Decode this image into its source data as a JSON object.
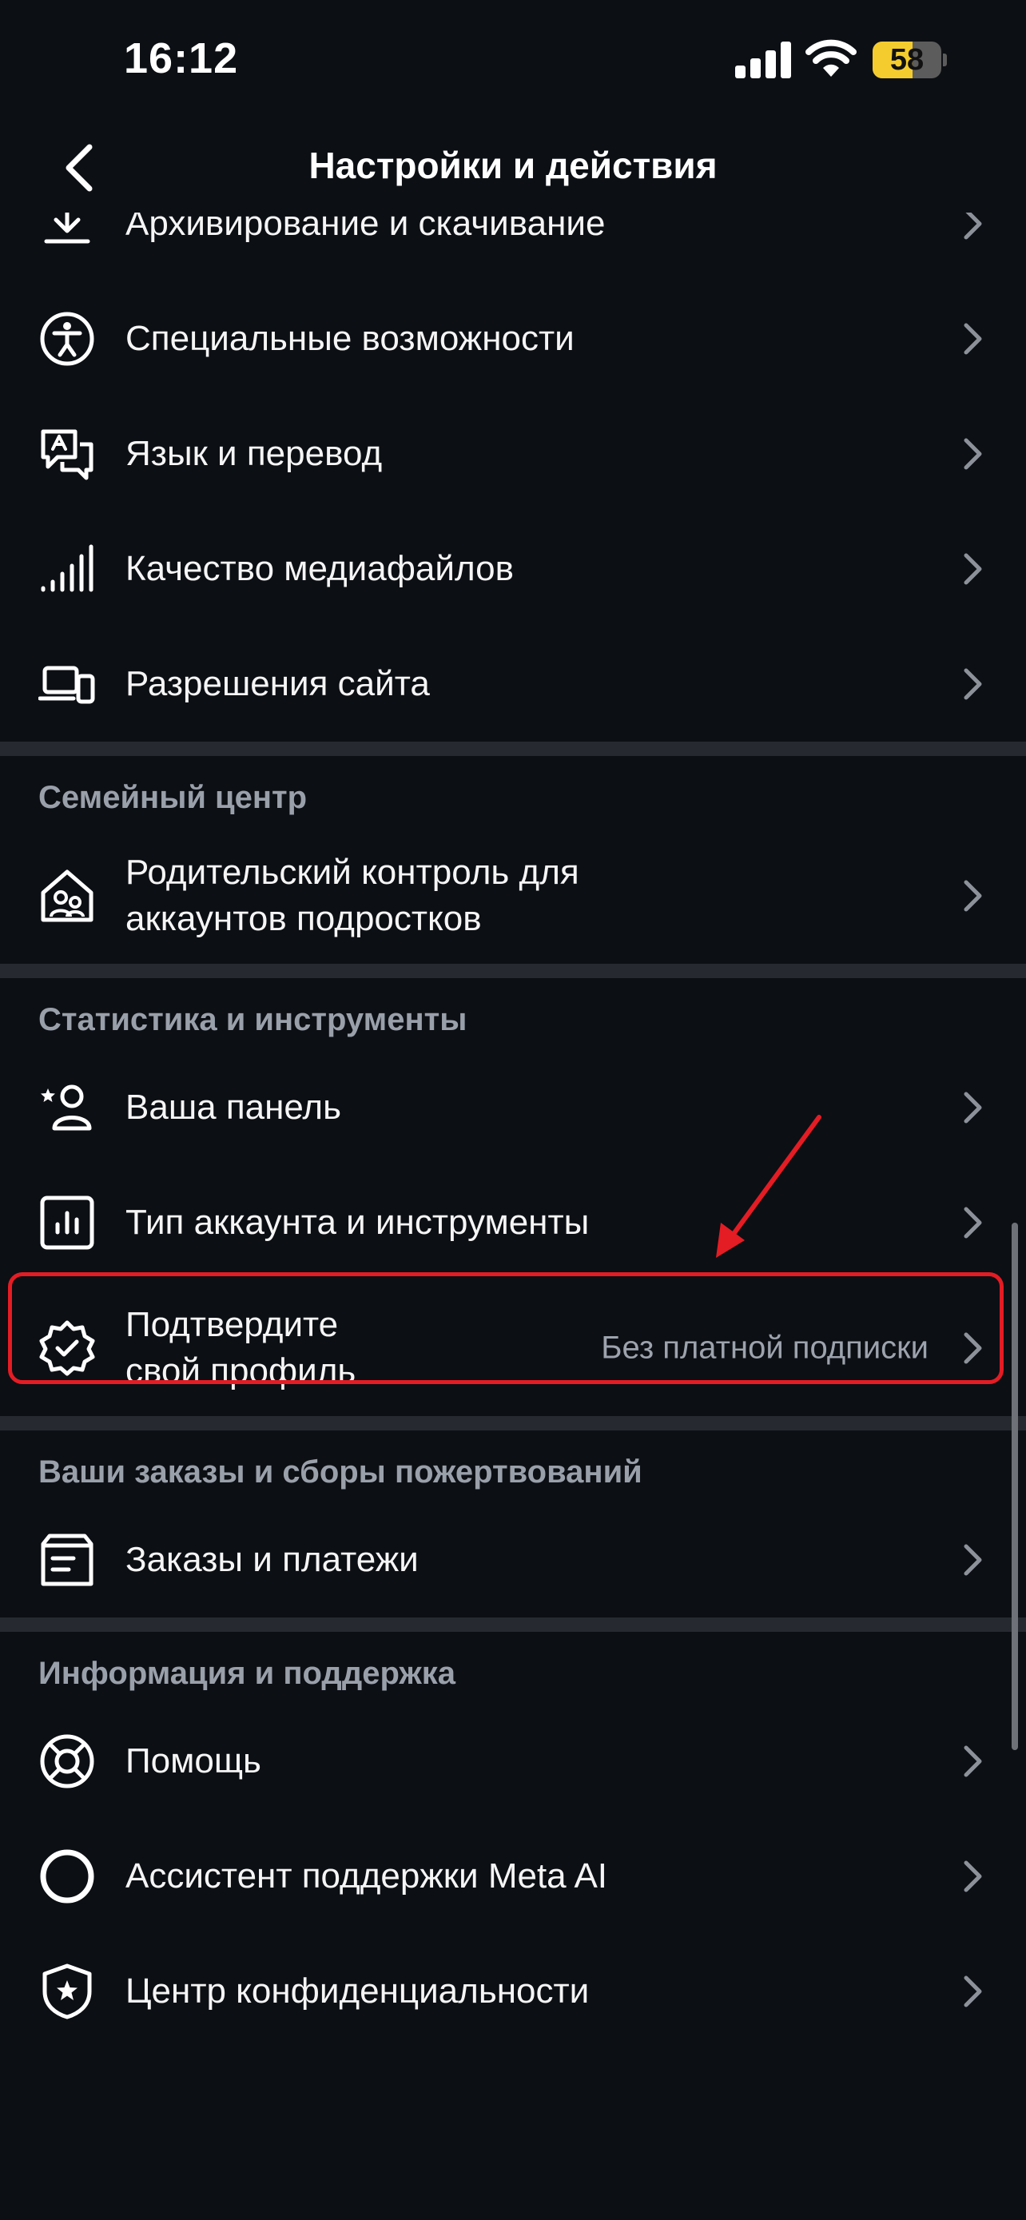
{
  "status_bar": {
    "time": "16:12",
    "battery": "58",
    "battery_level": 0.58
  },
  "header": {
    "title": "Настройки и действия",
    "back_icon": "chevron-left-icon"
  },
  "rows": {
    "archive": {
      "label": "Архивирование и скачивание",
      "icon": "download-icon"
    },
    "accessibility": {
      "label": "Специальные возможности",
      "icon": "accessibility-icon"
    },
    "language": {
      "label": "Язык и перевод",
      "icon": "translate-icon"
    },
    "media_quality": {
      "label": "Качество медиафайлов",
      "icon": "signal-bars-icon"
    },
    "site_permissions": {
      "label": "Разрешения сайта",
      "icon": "devices-icon"
    },
    "parental": {
      "label": "Родительский контроль для аккаунтов подростков",
      "icon": "family-home-icon"
    },
    "dashboard": {
      "label": "Ваша панель",
      "icon": "star-person-icon"
    },
    "account_type": {
      "label": "Тип аккаунта и инструменты",
      "icon": "chart-icon"
    },
    "verify": {
      "label": "Подтвердите свой профиль",
      "value": "Без платной подписки",
      "icon": "verified-badge-icon"
    },
    "orders": {
      "label": "Заказы и платежи",
      "icon": "receipt-box-icon"
    },
    "help": {
      "label": "Помощь",
      "icon": "lifebuoy-icon"
    },
    "meta_ai": {
      "label": "Ассистент поддержки Meta AI",
      "icon": "circle-icon"
    },
    "privacy_center": {
      "label": "Центр конфиденциальности",
      "icon": "shield-icon"
    }
  },
  "sections": {
    "family": "Семейный центр",
    "stats": "Статистика и инструменты",
    "orders": "Ваши заказы и сборы пожертвований",
    "info": "Информация и поддержка"
  },
  "colors": {
    "background": "#0c0f14",
    "divider": "#262a30",
    "secondary_text": "#9aa0aa",
    "highlight": "#e41c24",
    "battery": "#f5cc2e"
  }
}
